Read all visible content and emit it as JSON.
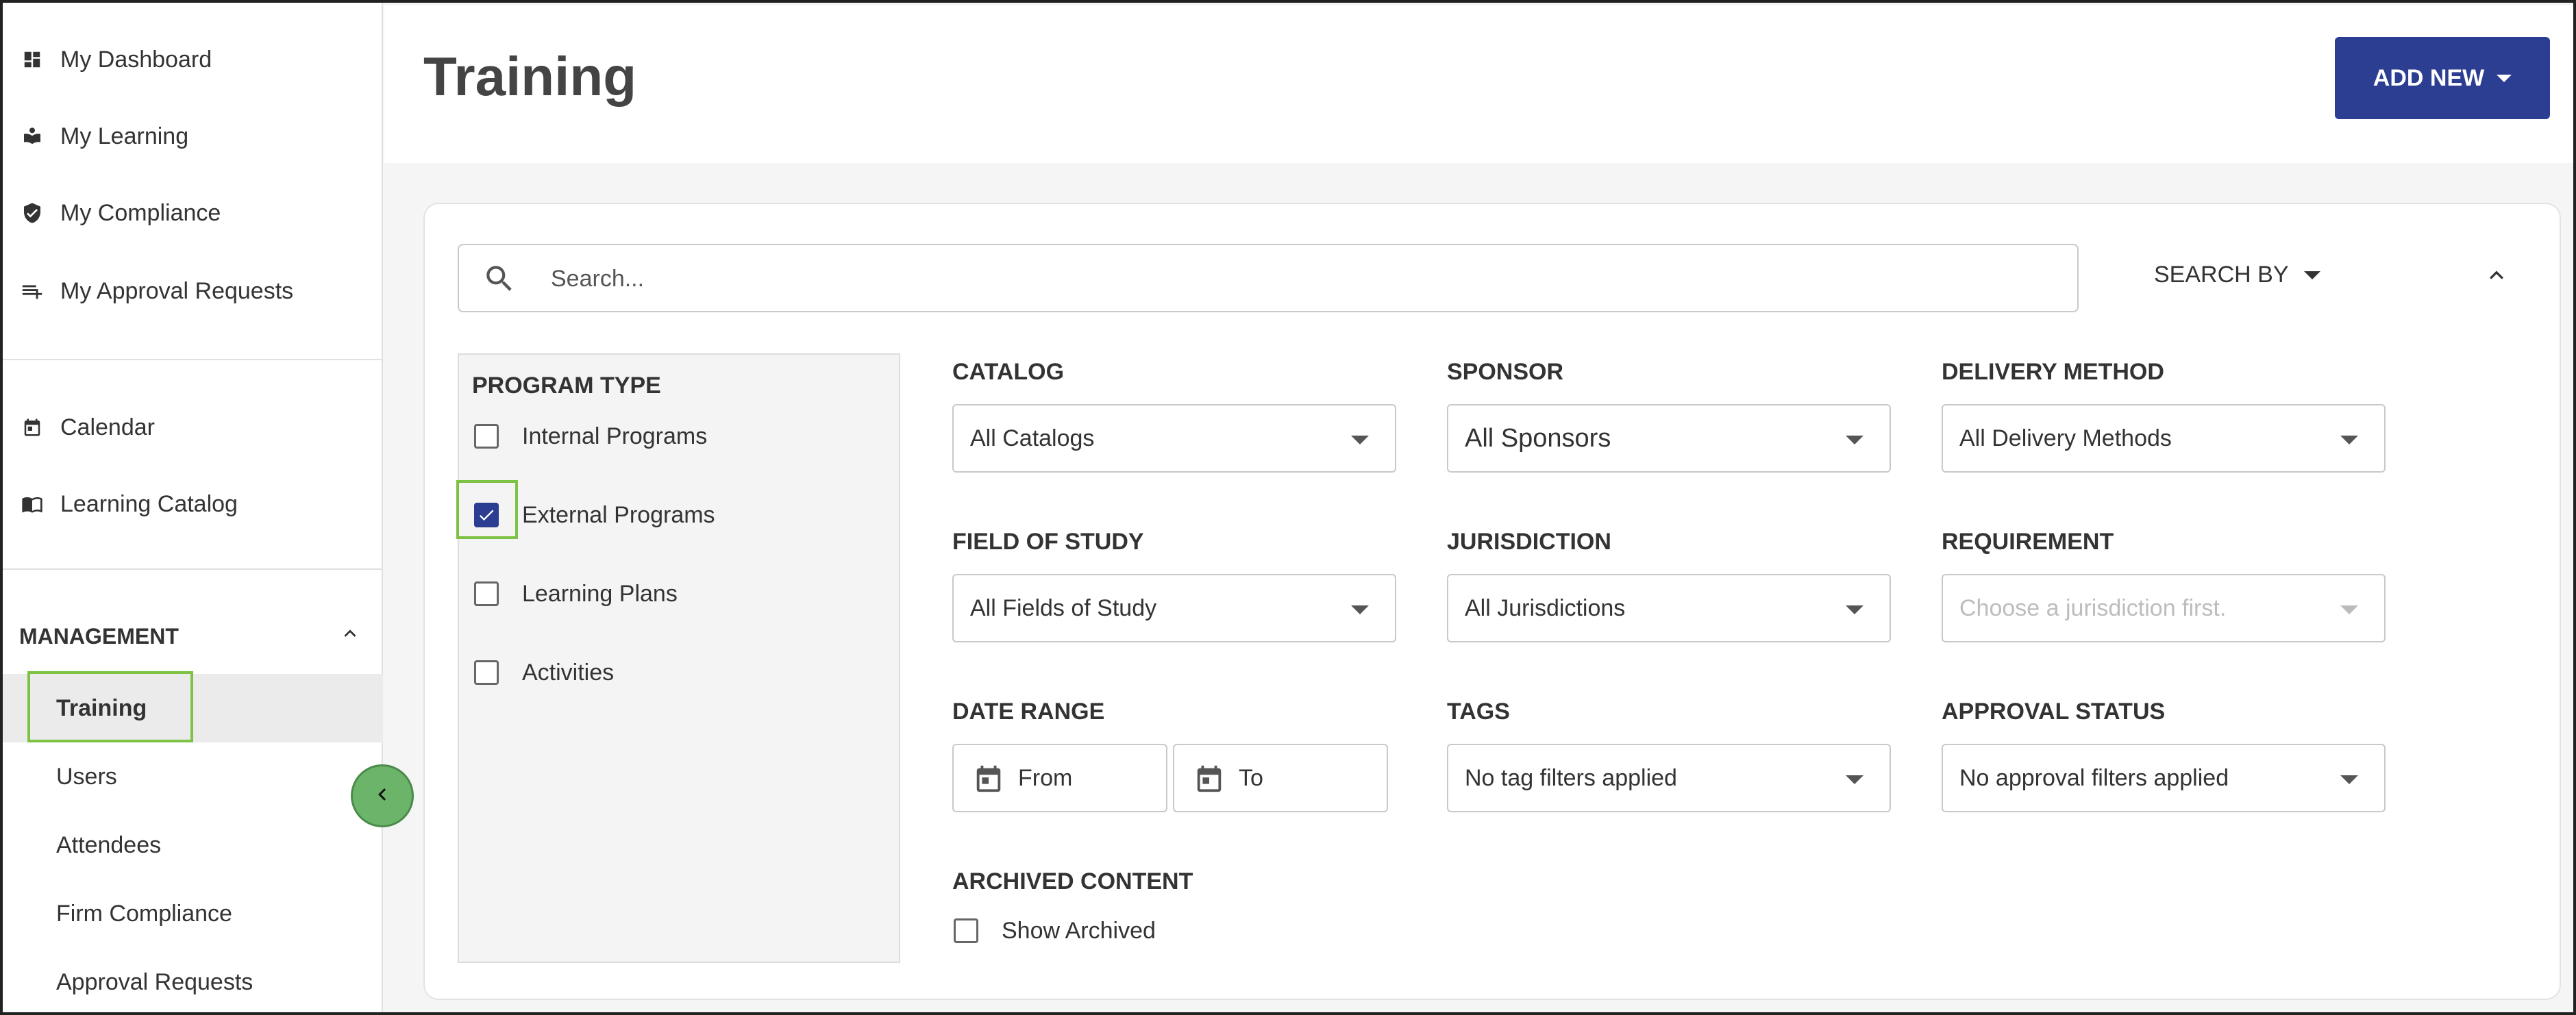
{
  "sidebar": {
    "nav": [
      {
        "label": "My Dashboard",
        "icon": "dashboard-icon"
      },
      {
        "label": "My Learning",
        "icon": "learning-icon"
      },
      {
        "label": "My Compliance",
        "icon": "shield-check-icon"
      },
      {
        "label": "My Approval Requests",
        "icon": "playlist-add-icon"
      },
      {
        "label": "Calendar",
        "icon": "calendar-icon"
      },
      {
        "label": "Learning Catalog",
        "icon": "book-icon"
      }
    ],
    "management": {
      "title": "MANAGEMENT",
      "items": [
        {
          "label": "Training",
          "active": true
        },
        {
          "label": "Users"
        },
        {
          "label": "Attendees"
        },
        {
          "label": "Firm Compliance"
        },
        {
          "label": "Approval Requests"
        }
      ]
    }
  },
  "header": {
    "title": "Training",
    "add_new": "ADD NEW"
  },
  "search": {
    "placeholder": "Search...",
    "search_by": "SEARCH BY"
  },
  "program_type": {
    "title": "PROGRAM TYPE",
    "options": [
      {
        "label": "Internal Programs",
        "checked": false
      },
      {
        "label": "External Programs",
        "checked": true
      },
      {
        "label": "Learning Plans",
        "checked": false
      },
      {
        "label": "Activities",
        "checked": false
      }
    ]
  },
  "filters": {
    "catalog": {
      "label": "CATALOG",
      "value": "All Catalogs"
    },
    "sponsor": {
      "label": "SPONSOR",
      "value": "All Sponsors"
    },
    "delivery_method": {
      "label": "DELIVERY METHOD",
      "value": "All Delivery Methods"
    },
    "field_of_study": {
      "label": "FIELD OF STUDY",
      "value": "All Fields of Study"
    },
    "jurisdiction": {
      "label": "JURISDICTION",
      "value": "All Jurisdictions"
    },
    "requirement": {
      "label": "REQUIREMENT",
      "value": "Choose a jurisdiction first."
    },
    "date_range": {
      "label": "DATE RANGE",
      "from": "From",
      "to": "To"
    },
    "tags": {
      "label": "TAGS",
      "value": "No tag filters applied"
    },
    "approval_status": {
      "label": "APPROVAL STATUS",
      "value": "No approval filters applied"
    },
    "archived": {
      "label": "ARCHIVED CONTENT",
      "option": "Show Archived",
      "checked": false
    }
  },
  "colors": {
    "primary": "#2c3e91",
    "highlight": "#7dc242",
    "collapse_button": "#6cb46a"
  }
}
